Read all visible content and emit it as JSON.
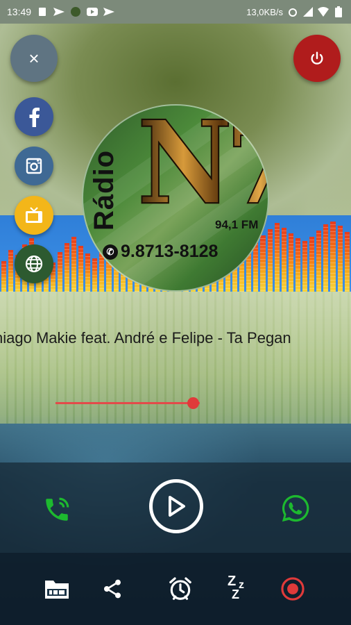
{
  "statusbar": {
    "time": "13:49",
    "speed": "13,0KB/s",
    "icons_left": [
      "sim-icon",
      "send-icon",
      "app-icon",
      "youtube-icon",
      "send-icon"
    ],
    "icons_right": [
      "alarm-icon",
      "signal-icon",
      "wifi-icon",
      "battery-icon"
    ]
  },
  "fab": {
    "close_glyph": "×",
    "icons": [
      "facebook-icon",
      "instagram-icon",
      "tv-icon",
      "globe-icon"
    ]
  },
  "logo": {
    "brand": "N7",
    "radio_word": "Rádio",
    "frequency": "94,1 FM",
    "phone": "9.8713-8128"
  },
  "player": {
    "now_playing": "hiago Makie feat. André e Felipe - Ta Pegan",
    "volume": 0.95
  },
  "colors": {
    "accent": "#e03a3a",
    "power": "#b01c1c",
    "facebook": "#3b5898",
    "call": "#1db92f",
    "whatsapp": "#1db92f"
  },
  "controls": [
    "call-icon",
    "play-icon",
    "whatsapp-icon"
  ],
  "bottom_icons": [
    "folder-icon",
    "share-icon",
    "alarm-icon",
    "sleep-icon",
    "record-icon"
  ]
}
